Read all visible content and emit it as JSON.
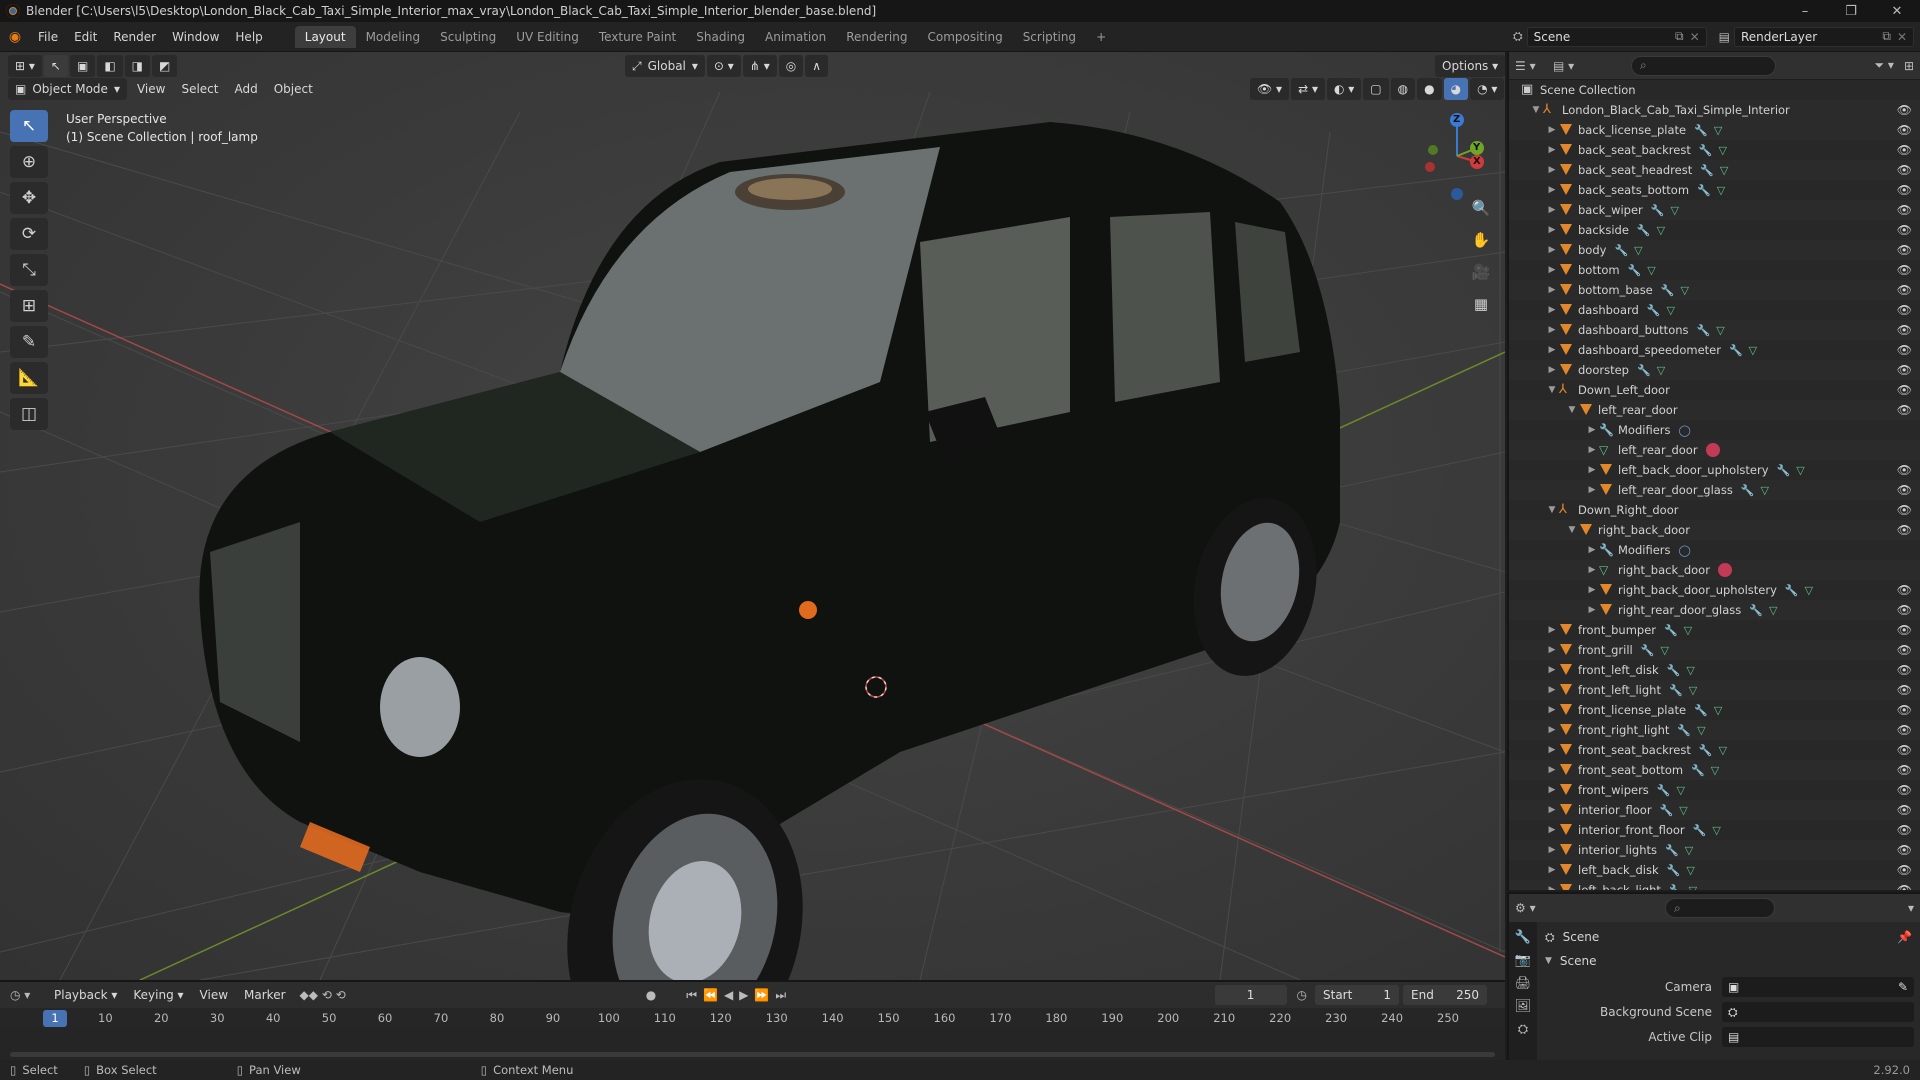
{
  "window": {
    "title": "Blender [C:\\Users\\l5\\Desktop\\London_Black_Cab_Taxi_Simple_Interior_max_vray\\London_Black_Cab_Taxi_Simple_Interior_blender_base.blend]",
    "minimize": "–",
    "maximize": "❐",
    "close": "✕"
  },
  "menus": [
    "File",
    "Edit",
    "Render",
    "Window",
    "Help"
  ],
  "workspaces": [
    "Layout",
    "Modeling",
    "Sculpting",
    "UV Editing",
    "Texture Paint",
    "Shading",
    "Animation",
    "Rendering",
    "Compositing",
    "Scripting",
    "+"
  ],
  "topright": {
    "scene": "Scene",
    "renderlayer": "RenderLayer"
  },
  "viewport": {
    "mode": "Object Mode",
    "menu": [
      "View",
      "Select",
      "Add",
      "Object"
    ],
    "transform": "Global",
    "options": "Options",
    "info_line1": "User Perspective",
    "info_line2": "(1) Scene Collection | roof_lamp",
    "gizmo": {
      "x": "X",
      "y": "Y",
      "z": "Z"
    }
  },
  "outliner": {
    "root": "Scene Collection",
    "collection": "London_Black_Cab_Taxi_Simple_Interior",
    "rows": [
      {
        "level": 2,
        "type": "mesh",
        "name": "back_license_plate",
        "mod": true,
        "eye": true
      },
      {
        "level": 2,
        "type": "mesh",
        "name": "back_seat_backrest",
        "mod": true,
        "eye": true
      },
      {
        "level": 2,
        "type": "mesh",
        "name": "back_seat_headrest",
        "mod": true,
        "eye": true
      },
      {
        "level": 2,
        "type": "mesh",
        "name": "back_seats_bottom",
        "mod": true,
        "eye": true
      },
      {
        "level": 2,
        "type": "mesh",
        "name": "back_wiper",
        "mod": true,
        "eye": true
      },
      {
        "level": 2,
        "type": "mesh",
        "name": "backside",
        "mod": true,
        "eye": true
      },
      {
        "level": 2,
        "type": "mesh",
        "name": "body",
        "mod": true,
        "eye": true
      },
      {
        "level": 2,
        "type": "mesh",
        "name": "bottom",
        "mod": true,
        "eye": true
      },
      {
        "level": 2,
        "type": "mesh",
        "name": "bottom_base",
        "mod": true,
        "eye": true
      },
      {
        "level": 2,
        "type": "mesh",
        "name": "dashboard",
        "mod": true,
        "eye": true
      },
      {
        "level": 2,
        "type": "mesh",
        "name": "dashboard_buttons",
        "mod": true,
        "eye": true
      },
      {
        "level": 2,
        "type": "mesh",
        "name": "dashboard_speedometer",
        "mod": true,
        "eye": true
      },
      {
        "level": 2,
        "type": "mesh",
        "name": "doorstep",
        "mod": true,
        "eye": true
      },
      {
        "level": 2,
        "type": "empty",
        "name": "Down_Left_door",
        "open": true,
        "eye": true
      },
      {
        "level": 3,
        "type": "mesh",
        "name": "left_rear_door",
        "open": true,
        "eye": true
      },
      {
        "level": 4,
        "type": "mod",
        "name": "Modifiers",
        "eye": false
      },
      {
        "level": 4,
        "type": "data",
        "name": "left_rear_door",
        "mat": true,
        "eye": false
      },
      {
        "level": 4,
        "type": "mesh",
        "name": "left_back_door_upholstery",
        "mod": true,
        "eye": true
      },
      {
        "level": 4,
        "type": "mesh",
        "name": "left_rear_door_glass",
        "mod": true,
        "eye": true
      },
      {
        "level": 2,
        "type": "empty",
        "name": "Down_Right_door",
        "open": true,
        "eye": true
      },
      {
        "level": 3,
        "type": "mesh",
        "name": "right_back_door",
        "open": true,
        "eye": true
      },
      {
        "level": 4,
        "type": "mod",
        "name": "Modifiers",
        "eye": false
      },
      {
        "level": 4,
        "type": "data",
        "name": "right_back_door",
        "mat": true,
        "eye": false
      },
      {
        "level": 4,
        "type": "mesh",
        "name": "right_back_door_upholstery",
        "mod": true,
        "eye": true
      },
      {
        "level": 4,
        "type": "mesh",
        "name": "right_rear_door_glass",
        "mod": true,
        "eye": true
      },
      {
        "level": 2,
        "type": "mesh",
        "name": "front_bumper",
        "mod": true,
        "eye": true
      },
      {
        "level": 2,
        "type": "mesh",
        "name": "front_grill",
        "mod": true,
        "eye": true
      },
      {
        "level": 2,
        "type": "mesh",
        "name": "front_left_disk",
        "mod": true,
        "eye": true
      },
      {
        "level": 2,
        "type": "mesh",
        "name": "front_left_light",
        "mod": true,
        "eye": true
      },
      {
        "level": 2,
        "type": "mesh",
        "name": "front_license_plate",
        "mod": true,
        "eye": true
      },
      {
        "level": 2,
        "type": "mesh",
        "name": "front_right_light",
        "mod": true,
        "eye": true
      },
      {
        "level": 2,
        "type": "mesh",
        "name": "front_seat_backrest",
        "mod": true,
        "eye": true
      },
      {
        "level": 2,
        "type": "mesh",
        "name": "front_seat_bottom",
        "mod": true,
        "eye": true
      },
      {
        "level": 2,
        "type": "mesh",
        "name": "front_wipers",
        "mod": true,
        "eye": true
      },
      {
        "level": 2,
        "type": "mesh",
        "name": "interior_floor",
        "mod": true,
        "eye": true
      },
      {
        "level": 2,
        "type": "mesh",
        "name": "interior_front_floor",
        "mod": true,
        "eye": true
      },
      {
        "level": 2,
        "type": "mesh",
        "name": "interior_lights",
        "mod": true,
        "eye": true
      },
      {
        "level": 2,
        "type": "mesh",
        "name": "left_back_disk",
        "mod": true,
        "eye": true
      },
      {
        "level": 2,
        "type": "mesh",
        "name": "left_back_light",
        "mod": true,
        "eye": true
      }
    ]
  },
  "properties": {
    "context": "Scene",
    "panel": "Scene",
    "camera_label": "Camera",
    "bgscene_label": "Background Scene",
    "clip_label": "Active Clip"
  },
  "timeline": {
    "menu": [
      "Playback",
      "Keying",
      "View",
      "Marker"
    ],
    "current": "1",
    "start_label": "Start",
    "start": "1",
    "end_label": "End",
    "end": "250",
    "ticks": [
      "10",
      "20",
      "30",
      "40",
      "50",
      "60",
      "70",
      "80",
      "90",
      "100",
      "110",
      "120",
      "130",
      "140",
      "150",
      "160",
      "170",
      "180",
      "190",
      "200",
      "210",
      "220",
      "230",
      "240",
      "250"
    ],
    "marker": "1"
  },
  "statusbar": {
    "select": "Select",
    "box": "Box Select",
    "pan": "Pan View",
    "context": "Context Menu",
    "version": "2.92.0"
  }
}
